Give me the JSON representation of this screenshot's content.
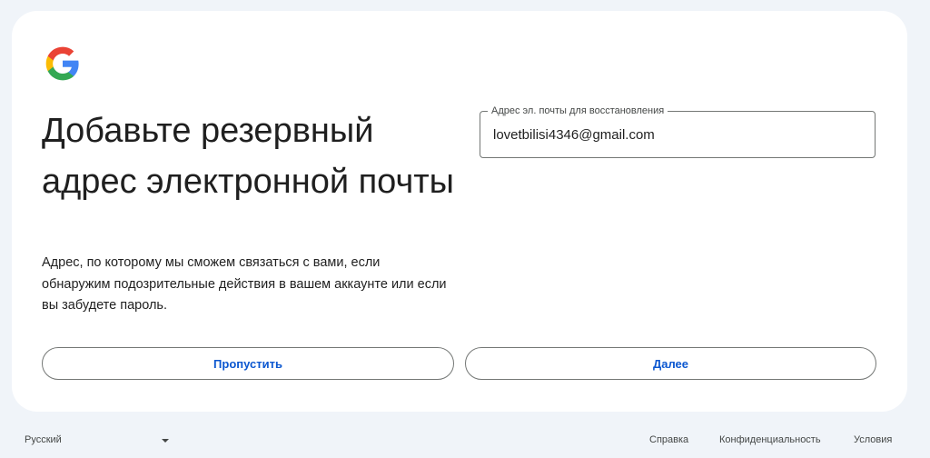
{
  "header": {
    "logo_icon": "google-g-icon"
  },
  "main": {
    "title": "Добавьте резервный адрес электронной почты",
    "description": "Адрес, по которому мы сможем связаться с вами, если обнаружим подозрительные действия в вашем аккаунте или если вы забудете пароль."
  },
  "recovery_email": {
    "label": "Адрес эл. почты для восстановления",
    "value": "lovetbilisi4346@gmail.com"
  },
  "actions": {
    "skip_label": "Пропустить",
    "next_label": "Далее"
  },
  "footer": {
    "language": "Русский",
    "language_icon": "caret-down-icon",
    "help": "Справка",
    "privacy": "Конфиденциальность",
    "terms": "Условия"
  },
  "colors": {
    "accent": "#0b57d0",
    "background": "#f0f4f9",
    "card": "#ffffff",
    "google_blue": "#4285F4",
    "google_red": "#EA4335",
    "google_yellow": "#FBBC05",
    "google_green": "#34A853"
  }
}
